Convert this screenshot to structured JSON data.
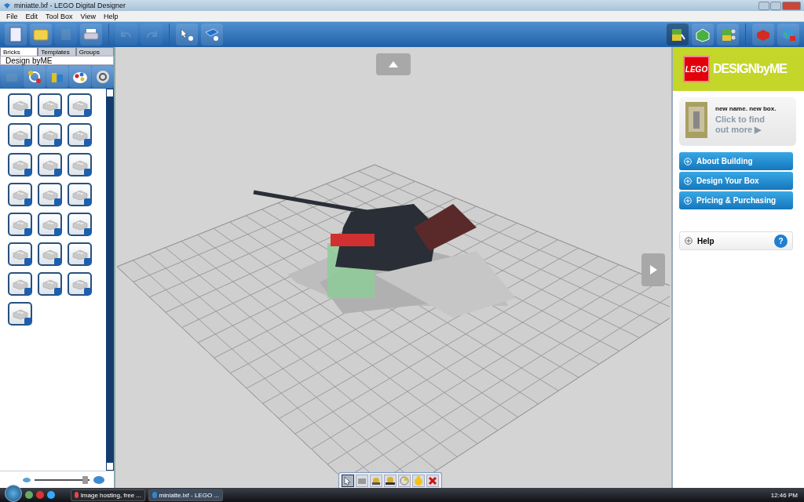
{
  "window": {
    "title": "miniatte.lxf - LEGO Digital Designer"
  },
  "menu": [
    "File",
    "Edit",
    "Tool Box",
    "View",
    "Help"
  ],
  "toolbar": [
    {
      "kind": "new",
      "disabled": false
    },
    {
      "kind": "open",
      "disabled": false
    },
    {
      "kind": "save",
      "disabled": true
    },
    {
      "kind": "print",
      "disabled": false
    },
    {
      "kind": "undo",
      "disabled": true
    },
    {
      "kind": "redo",
      "disabled": true
    },
    {
      "kind": "pointer-help",
      "disabled": false
    },
    {
      "kind": "book-help",
      "disabled": false
    }
  ],
  "modes": [
    {
      "kind": "build",
      "selected": true
    },
    {
      "kind": "view",
      "selected": false
    },
    {
      "kind": "instructions",
      "selected": false
    }
  ],
  "tabs": [
    {
      "label": "Bricks",
      "selected": true
    },
    {
      "label": "Templates",
      "selected": false
    },
    {
      "label": "Groups",
      "selected": false
    }
  ],
  "palette": {
    "title": "Design byME"
  },
  "zoom": {
    "level": 0.92
  },
  "edit_tools": [
    {
      "kind": "select",
      "selected": true
    },
    {
      "kind": "clone",
      "selected": false
    },
    {
      "kind": "hinge",
      "selected": false
    },
    {
      "kind": "hinge-align",
      "selected": false
    },
    {
      "kind": "paint",
      "selected": false
    },
    {
      "kind": "minifig",
      "selected": false
    },
    {
      "kind": "delete",
      "selected": false
    }
  ],
  "brand": {
    "logo": "LEGO",
    "title": "DESIGNbyME"
  },
  "promo": {
    "headline": "new name. new box.",
    "link": "Click to find out more ▶"
  },
  "sections": [
    "About Building",
    "Design Your Box",
    "Pricing & Purchasing"
  ],
  "help": {
    "label": "Help",
    "icon": "?"
  },
  "taskbar": {
    "tasks": [
      {
        "label": "Image hosting, free ...",
        "selected": false
      },
      {
        "label": "miniatte.lxf - LEGO ...",
        "selected": true
      }
    ],
    "clock": "12:46 PM"
  }
}
